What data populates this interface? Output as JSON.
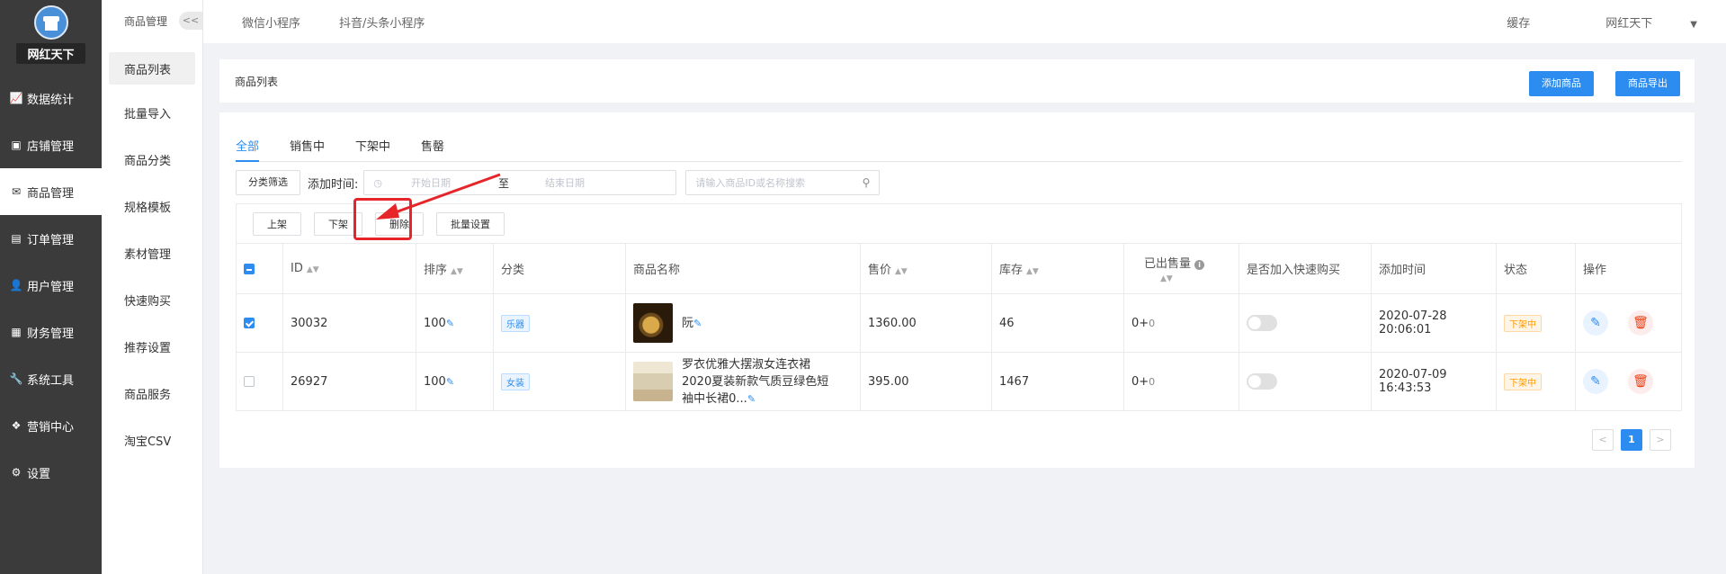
{
  "brand": {
    "name": "网红天下"
  },
  "nav": [
    {
      "label": "数据统计",
      "icon": "chart-icon"
    },
    {
      "label": "店铺管理",
      "icon": "store-icon"
    },
    {
      "label": "商品管理",
      "icon": "goods-icon",
      "active": true
    },
    {
      "label": "订单管理",
      "icon": "order-icon"
    },
    {
      "label": "用户管理",
      "icon": "user-icon"
    },
    {
      "label": "财务管理",
      "icon": "finance-icon"
    },
    {
      "label": "系统工具",
      "icon": "wrench-icon"
    },
    {
      "label": "营销中心",
      "icon": "marketing-icon"
    },
    {
      "label": "设置",
      "icon": "gear-icon"
    }
  ],
  "submenu": {
    "title": "商品管理",
    "collapse": "<<",
    "items": [
      "商品列表",
      "批量导入",
      "商品分类",
      "规格模板",
      "素材管理",
      "快速购买",
      "推荐设置",
      "商品服务",
      "淘宝CSV"
    ]
  },
  "topbar": {
    "tabs": [
      "微信小程序",
      "抖音/头条小程序"
    ],
    "cache": "缓存",
    "user": "网红天下"
  },
  "header": {
    "title": "商品列表",
    "add_label": "添加商品",
    "export_label": "商品导出"
  },
  "tabs": [
    "全部",
    "销售中",
    "下架中",
    "售罄"
  ],
  "filters": {
    "category_btn": "分类筛选",
    "time_label": "添加时间:",
    "start_placeholder": "开始日期",
    "sep": "至",
    "end_placeholder": "结束日期",
    "search_placeholder": "请输入商品ID或名称搜索"
  },
  "actions": [
    "上架",
    "下架",
    "删除",
    "批量设置"
  ],
  "table": {
    "headers": [
      "ID",
      "排序",
      "分类",
      "商品名称",
      "售价",
      "库存",
      "已出售量",
      "是否加入快速购买",
      "添加时间",
      "状态",
      "操作"
    ],
    "rows": [
      {
        "checked": true,
        "id": "30032",
        "sort": "100",
        "category": "乐器",
        "name": "阮",
        "price": "1360.00",
        "stock": "46",
        "sold": "0+",
        "sold_extra": "0",
        "time": "2020-07-28 20:06:01",
        "status": "下架中"
      },
      {
        "checked": false,
        "id": "26927",
        "sort": "100",
        "category": "女装",
        "name": "罗衣优雅大摆淑女连衣裙2020夏装新款气质豆绿色短袖中长裙0...",
        "price": "395.00",
        "stock": "1467",
        "sold": "0+",
        "sold_extra": "0",
        "time": "2020-07-09 16:43:53",
        "status": "下架中"
      }
    ]
  },
  "pager": {
    "prev": "<",
    "current": "1",
    "next": ">"
  },
  "colors": {
    "primary": "#2d8cf0",
    "sidebar": "#3b3b3b",
    "annotation": "#e5252a"
  }
}
